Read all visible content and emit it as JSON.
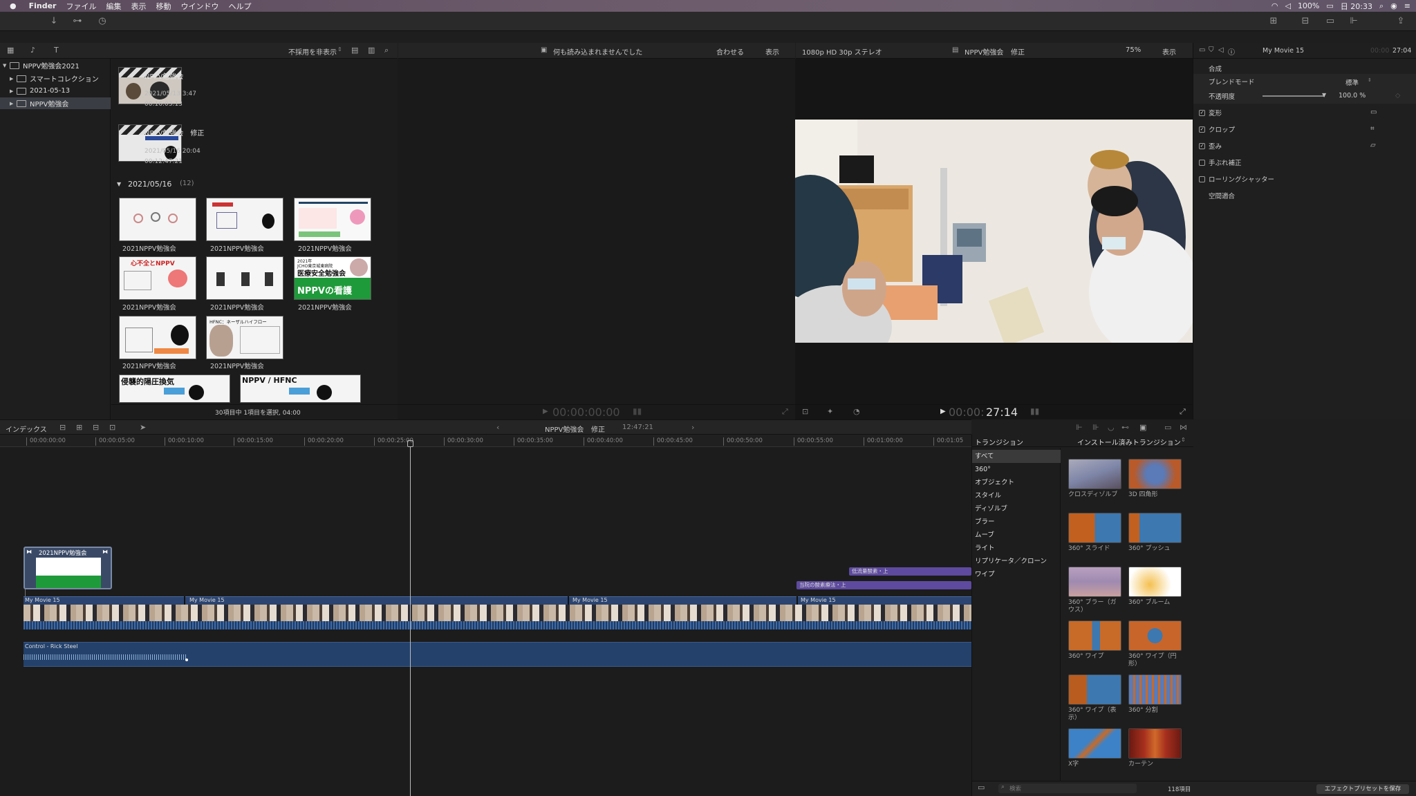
{
  "menubar": {
    "app": "Finder",
    "items": [
      "ファイル",
      "編集",
      "表示",
      "移動",
      "ウインドウ",
      "ヘルプ"
    ],
    "battery": "100%",
    "clock": "日 20:33"
  },
  "browser_bar": {
    "hide_rejected": "不採用を非表示",
    "nothing_loaded": "何も読み込まれませんでした",
    "fit": "合わせる",
    "view": "表示"
  },
  "viewer_bar": {
    "format": "1080p HD 30p ステレオ",
    "project": "NPPV勉強会",
    "project_suffix": "修正",
    "zoom": "75%",
    "view": "表示"
  },
  "inspector_header": {
    "title": "My Movie 15",
    "time": "27:04"
  },
  "library": {
    "root": "NPPV勉強会2021",
    "items": [
      "スマートコレクション",
      "2021-05-13",
      "NPPV勉強会"
    ]
  },
  "browser": {
    "projects": [
      {
        "name": "NPPV勉強会",
        "date": "2021/05/13 3:47",
        "duration": "00:16:03:13"
      },
      {
        "name": "NPPV勉強会　修正",
        "date": "2021/05/16 20:04",
        "duration": "00:12:47:21"
      }
    ],
    "group_title": "2021/05/16",
    "group_count": "(12)",
    "clip_label": "2021NPPV勉強会",
    "status": "30項目中 1項目を選択, 04:00"
  },
  "clip_texts": {
    "t1": "心不全とNPPV",
    "t2a": "2021年",
    "t2b": "JCHO東京城東病院",
    "t2c": "医療安全勉強会",
    "t2d": "NPPVの看護",
    "t3": "HFNC：ネーザルハイフロー",
    "t4": "侵襲的陽圧換気",
    "t5": "NPPV / HFNC"
  },
  "timecodes": {
    "empty_viewer": "00:00:00:00",
    "viewer_prefix": "00:00:",
    "viewer_big": "27:14"
  },
  "inspector": {
    "compositing": "合成",
    "blend_mode": "ブレンドモード",
    "blend_value": "標準",
    "opacity": "不透明度",
    "opacity_value": "100.0 %",
    "opacity_fraction": 1.0,
    "transform": "変形",
    "crop": "クロップ",
    "distort": "歪み",
    "stabilization": "手ぶれ補正",
    "rolling_shutter": "ローリングシャッター",
    "spatial_conform": "空間適合",
    "save_preset": "エフェクトプリセットを保存"
  },
  "timeline_bar": {
    "index": "インデックス",
    "project": "NPPV勉強会",
    "project_suffix": "修正",
    "duration": "12:47:21"
  },
  "ruler": [
    "00:00:00:00",
    "00:00:05:00",
    "00:00:10:00",
    "00:00:15:00",
    "00:00:20:00",
    "00:00:25:00",
    "00:00:30:00",
    "00:00:35:00",
    "00:00:40:00",
    "00:00:45:00",
    "00:00:50:00",
    "00:00:55:00",
    "00:01:00:00",
    "00:01:05"
  ],
  "timeline": {
    "connected_clip": "2021NPPV勉強会",
    "title1": "低流量酸素・上",
    "title2": "当院の酸素療法・上",
    "primary_clip": "My Movie 15",
    "audio_clip": "Control - Rick Steel"
  },
  "transitions": {
    "header": "トランジション",
    "installed": "インストール済みトランジション",
    "categories": [
      "すべて",
      "360°",
      "オブジェクト",
      "スタイル",
      "ディゾルブ",
      "ブラー",
      "ムーブ",
      "ライト",
      "リプリケータ／クローン",
      "ワイプ"
    ],
    "items": [
      {
        "name": "クロスディゾルブ",
        "color": "#7e86a8"
      },
      {
        "name": "3D 四角形",
        "color": "#b85a2a"
      },
      {
        "name": "360° スライド",
        "color": "#c2601f"
      },
      {
        "name": "360° プッシュ",
        "color": "#3d78b0"
      },
      {
        "name": "360° ブラー（ガウス）",
        "color": "#9f8ab0"
      },
      {
        "name": "360° ブルーム",
        "color": "#f2e6c8"
      },
      {
        "name": "360° ワイプ",
        "color": "#c86a28"
      },
      {
        "name": "360° ワイプ（円形）",
        "color": "#c8652a"
      },
      {
        "name": "360° ワイプ（表示）",
        "color": "#b85c20"
      },
      {
        "name": "360° 分割",
        "color": "#5a7ab8"
      },
      {
        "name": "X字",
        "color": "#3d82c6"
      },
      {
        "name": "カーテン",
        "color": "#a8301e"
      }
    ],
    "search_placeholder": "検索",
    "count": "118項目"
  },
  "colors": {
    "accent": "#3a6ea8",
    "title_purple": "#5e4a9e",
    "audio_blue": "#244a78",
    "green_slide": "#1f9a3a"
  }
}
